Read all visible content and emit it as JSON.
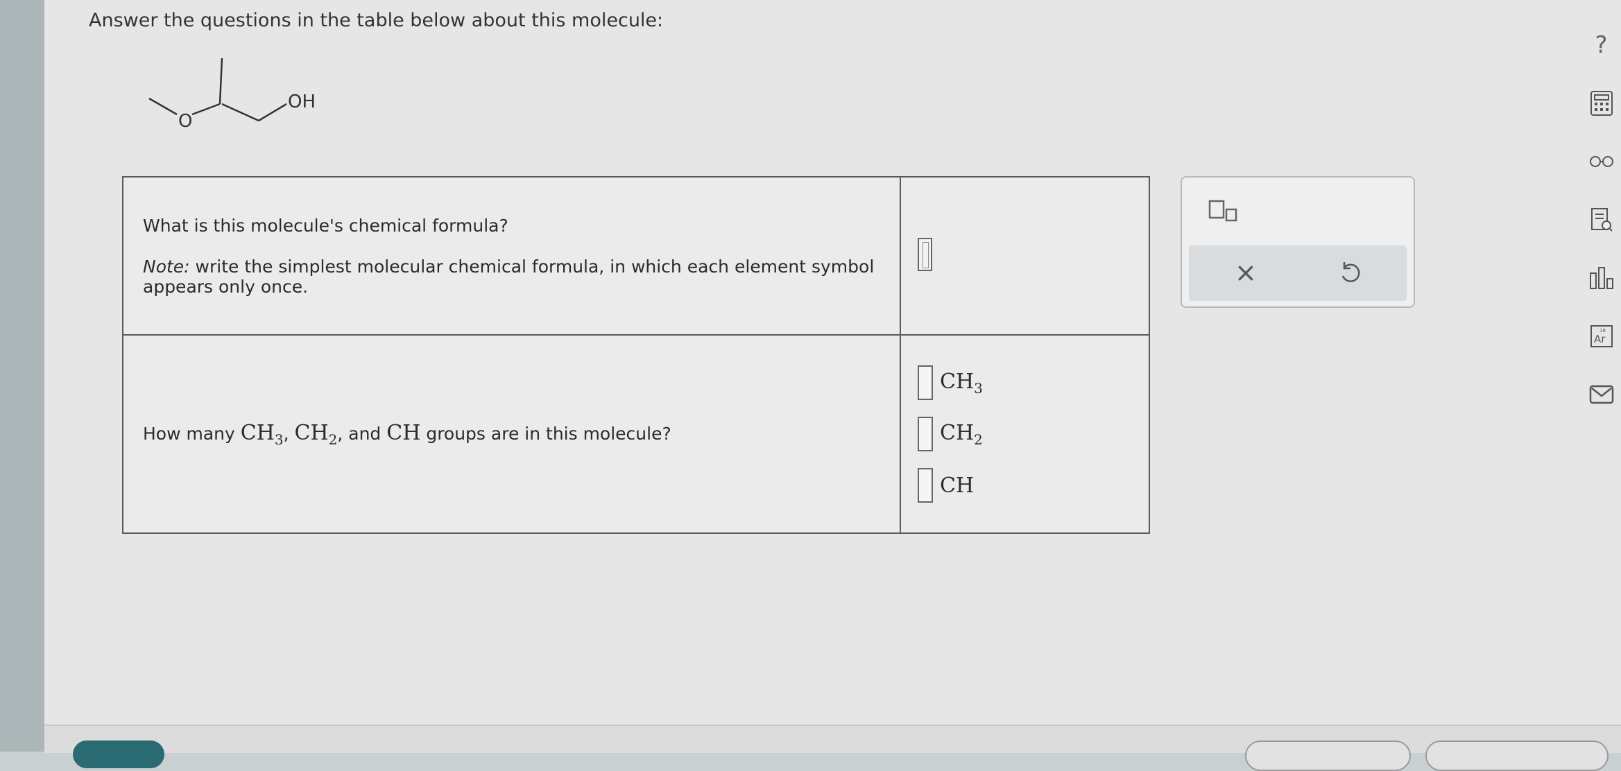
{
  "prompt": "Answer the questions in the table below about this molecule:",
  "molecule": {
    "oh_label": "OH",
    "o_label": "O"
  },
  "questions": {
    "q1": {
      "title": "What is this molecule's chemical formula?",
      "note_label": "Note:",
      "note_text": " write the simplest molecular chemical formula, in which each element symbol appears only once."
    },
    "q2": {
      "prefix": "How many ",
      "ch3_main": "CH",
      "ch3_sub": "3",
      "sep1": ", ",
      "ch2_main": "CH",
      "ch2_sub": "2",
      "sep2": ", and ",
      "ch": "CH",
      "suffix": " groups are in this molecule?"
    },
    "groups": [
      {
        "main": "CH",
        "sub": "3"
      },
      {
        "main": "CH",
        "sub": "2"
      },
      {
        "main": "CH",
        "sub": ""
      }
    ]
  },
  "toolbox": {
    "clear": "×"
  },
  "side": {
    "help": "?"
  },
  "icons": [
    "subscript-template-icon",
    "close-icon",
    "undo-icon",
    "help-icon",
    "calculator-icon",
    "glasses-icon",
    "reference-icon",
    "bar-chart-icon",
    "periodic-table-icon",
    "mail-icon"
  ]
}
